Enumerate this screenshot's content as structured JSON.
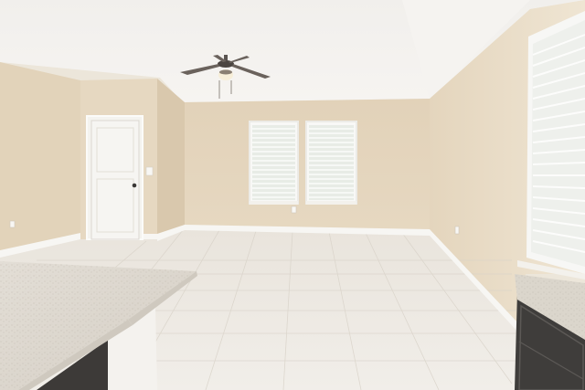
{
  "scene": {
    "description_free": true,
    "colors": {
      "ceiling": "#f3f1ee",
      "wall_back": "#e4d5bd",
      "wall_left": "#e3d4bc",
      "wall_right": "#e9ddc8",
      "floor": "#ece8e1",
      "trim": "#f7f6f3",
      "door": "#f6f5f2",
      "counter": "#dcd6cc",
      "cabinet": "#3e3c3b",
      "window_glass": "#f2f3f1"
    },
    "icons": [
      "ceiling-fan-icon",
      "door-knob-icon",
      "window-blinds-icon",
      "outlet-icon",
      "light-switch-icon"
    ]
  }
}
